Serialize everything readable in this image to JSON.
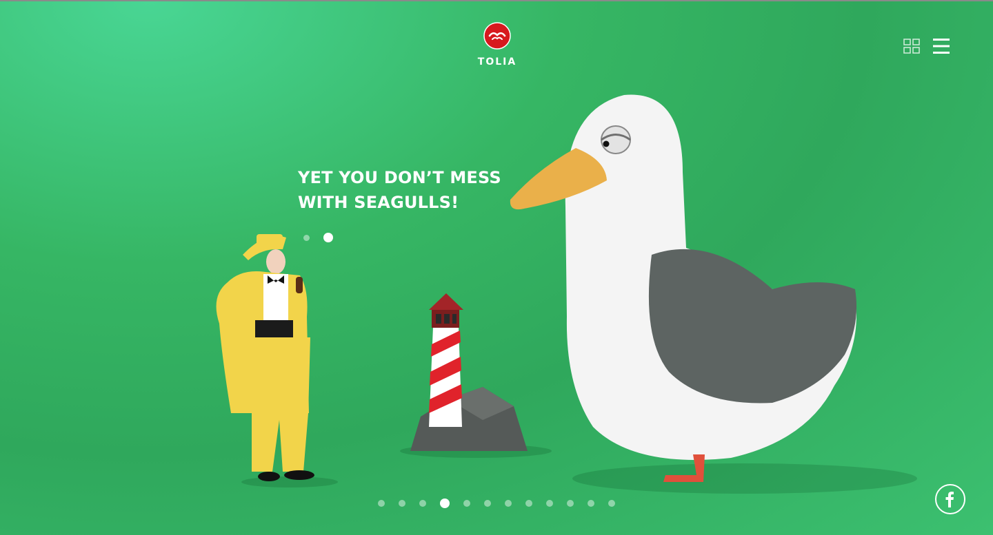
{
  "brand": {
    "name": "TOLIA",
    "logo_icon": "seagull-logo-icon",
    "color": "#d7191e"
  },
  "header": {
    "grid_icon": "grid-view-icon",
    "menu_icon": "hamburger-menu-icon"
  },
  "slide": {
    "headline_lines": [
      "YET YOU DON’T MESS",
      "WITH SEAGULLS!"
    ],
    "sub_dots": {
      "total": 2,
      "active_index": 1
    }
  },
  "pager": {
    "total": 12,
    "active_index": 3
  },
  "social": {
    "facebook_icon": "facebook-icon"
  },
  "colors": {
    "background": "#36b664",
    "text": "#ffffff"
  }
}
